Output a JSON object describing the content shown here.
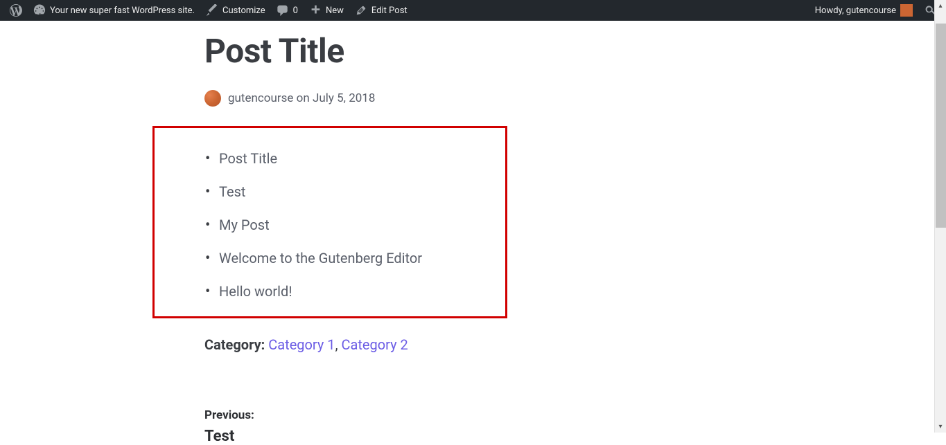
{
  "adminbar": {
    "site_name": "Your new super fast WordPress site.",
    "customize": "Customize",
    "comments_count": "0",
    "new": "New",
    "edit_post": "Edit Post",
    "howdy": "Howdy, gutencourse"
  },
  "post": {
    "title": "Post Title",
    "author": "gutencourse",
    "on": "on",
    "date": "July 5, 2018",
    "list_items": [
      "Post Title",
      "Test",
      "My Post",
      "Welcome to the Gutenberg Editor",
      "Hello world!"
    ],
    "category_label": "Category:",
    "categories": [
      "Category 1",
      "Category 2"
    ],
    "category_separator": ", "
  },
  "nav": {
    "previous_label": "Previous:",
    "previous_title": "Test"
  }
}
